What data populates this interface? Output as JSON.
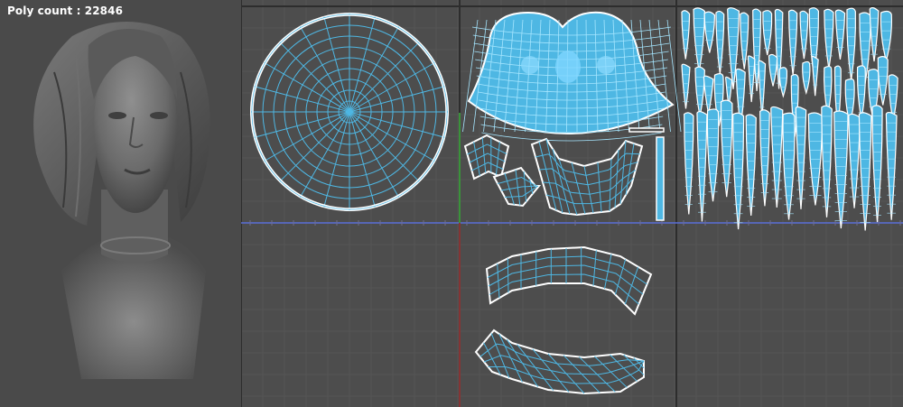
{
  "viewport": {
    "poly_count_label": "Poly count : 22846",
    "model_icon": "female-head-bust-sculpt"
  },
  "uv_editor": {
    "colors": {
      "background": "#4d4d4d",
      "grid_minor": "#555555",
      "grid_major": "#2d2d2d",
      "uv_fill": "#4eb7e3",
      "uv_wire": "#a6e6ff",
      "uv_border": "#ffffff",
      "u_axis": "#5a6ed8",
      "v_axis": "#3fb53f",
      "neg_u_axis": "#c03a3a"
    },
    "shells": [
      "cap-disc-shell",
      "scalp-shell",
      "ear-shell-left",
      "ear-shell-right",
      "neck-collar-shell",
      "eyelid-strip-shell",
      "hair-strands-shells",
      "upper-band-shell",
      "lower-band-shell"
    ]
  }
}
